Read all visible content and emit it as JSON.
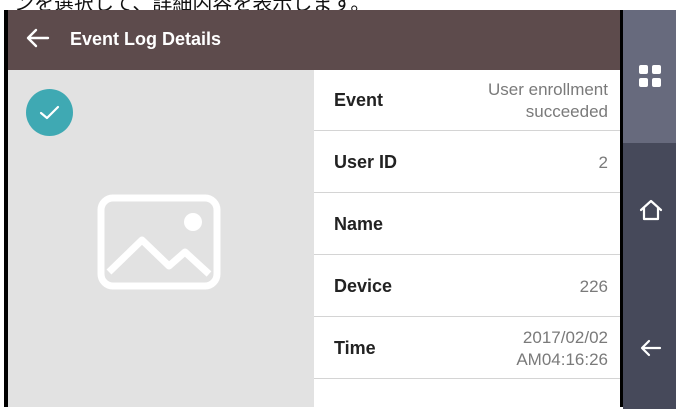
{
  "caption": "ンを選択して、詳細内容を表示します。",
  "header": {
    "back_icon": "arrow-left-icon",
    "title": "Event Log Details"
  },
  "photo": {
    "status_icon": "check-icon",
    "placeholder_icon": "image-placeholder-icon"
  },
  "details": {
    "rows": [
      {
        "label": "Event",
        "value": "User enrollment succeeded"
      },
      {
        "label": "User ID",
        "value": "2"
      },
      {
        "label": "Name",
        "value": ""
      },
      {
        "label": "Device",
        "value": "226"
      },
      {
        "label": "Time",
        "value": "2017/02/02 AM04:16:26"
      }
    ]
  },
  "sidebar": {
    "buttons": [
      {
        "icon": "apps-grid-icon",
        "color": "#676a7d"
      },
      {
        "icon": "home-icon",
        "color": "#46495a"
      },
      {
        "icon": "arrow-left-icon",
        "color": "#46495a"
      }
    ]
  },
  "colors": {
    "header": "#5d4b4c",
    "accent": "#3fa9b3",
    "photo_background": "#e2e2e2",
    "sidebar": "#46495a"
  }
}
